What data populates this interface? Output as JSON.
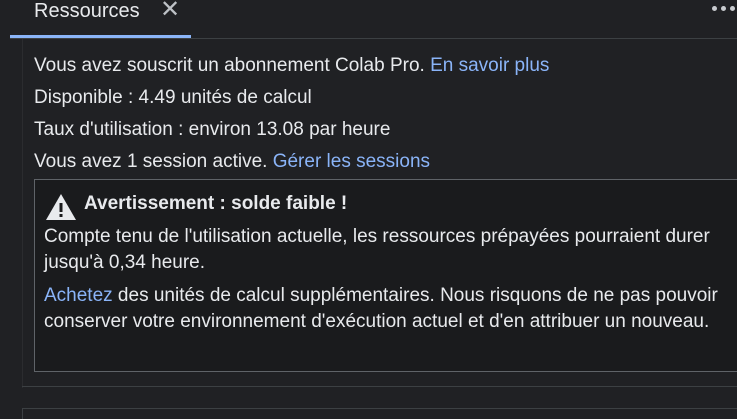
{
  "tab": {
    "label": "Ressources",
    "close": "✕"
  },
  "info": {
    "subscription_text": "Vous avez souscrit un abonnement Colab Pro.",
    "learn_more_link": "En savoir plus",
    "available": "Disponible : 4.49 unités de calcul",
    "usage_rate": "Taux d'utilisation : environ 13.08 par heure",
    "sessions_text": "Vous avez 1 session active.",
    "manage_sessions_link": "Gérer les sessions"
  },
  "warning": {
    "icon": "warning-triangle-icon",
    "title": "Avertissement : solde faible !",
    "body": "Compte tenu de l'utilisation actuelle, les ressources prépayées pourraient durer jusqu'à 0,34 heure.",
    "buy_link": "Achetez",
    "buy_text": " des unités de calcul supplémentaires. Nous risquons de ne pas pouvoir conserver votre environnement d'exécution actuel et d'en attribuer un nouveau."
  },
  "colors": {
    "accent": "#8ab4f8",
    "background": "#202124",
    "text": "#e8eaed"
  }
}
